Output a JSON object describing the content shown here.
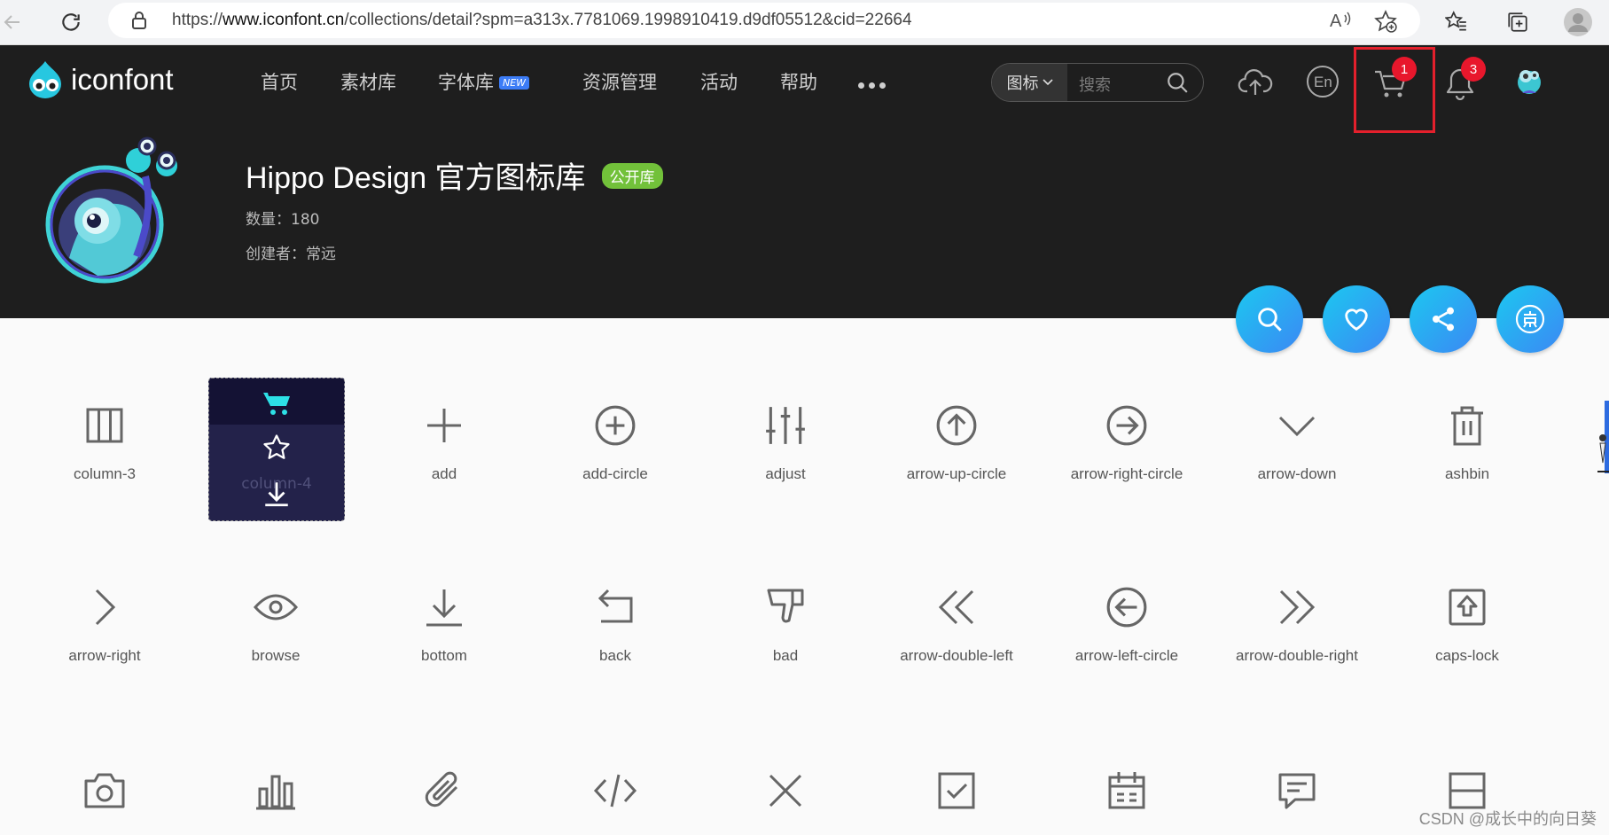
{
  "browser": {
    "url_prefix": "https://",
    "url_host": "www.iconfont.cn",
    "url_path": "/collections/detail?spm=a313x.7781069.1998910419.d9df05512&cid=22664"
  },
  "site": {
    "logo_text": "iconfont",
    "nav": [
      {
        "label": "首页"
      },
      {
        "label": "素材库"
      },
      {
        "label": "字体库",
        "badge": "NEW"
      },
      {
        "label": "资源管理"
      },
      {
        "label": "活动"
      },
      {
        "label": "帮助"
      }
    ],
    "search": {
      "scope": "图标",
      "placeholder": "搜索"
    },
    "cart_count": "1",
    "notification_count": "3"
  },
  "collection": {
    "title": "Hippo Design 官方图标库",
    "visibility_badge": "公开库",
    "count_label": "数量：",
    "count_value": "180",
    "creator_label": "创建者：",
    "creator_value": "常远"
  },
  "hover_card": {
    "label": "column-4"
  },
  "icons": [
    {
      "name": "column-3",
      "icon": "column-3-icon"
    },
    {
      "name": "column-4",
      "icon": "column-4-icon"
    },
    {
      "name": "add",
      "icon": "add-icon"
    },
    {
      "name": "add-circle",
      "icon": "add-circle-icon"
    },
    {
      "name": "adjust",
      "icon": "adjust-icon"
    },
    {
      "name": "arrow-up-circle",
      "icon": "arrow-up-circle-icon"
    },
    {
      "name": "arrow-right-circle",
      "icon": "arrow-right-circle-icon"
    },
    {
      "name": "arrow-down",
      "icon": "arrow-down-icon"
    },
    {
      "name": "ashbin",
      "icon": "ashbin-icon"
    },
    {
      "name": "arrow-right",
      "icon": "arrow-right-icon"
    },
    {
      "name": "browse",
      "icon": "browse-icon"
    },
    {
      "name": "bottom",
      "icon": "bottom-icon"
    },
    {
      "name": "back",
      "icon": "back-icon"
    },
    {
      "name": "bad",
      "icon": "bad-icon"
    },
    {
      "name": "arrow-double-left",
      "icon": "arrow-double-left-icon"
    },
    {
      "name": "arrow-left-circle",
      "icon": "arrow-left-circle-icon"
    },
    {
      "name": "arrow-double-right",
      "icon": "arrow-double-right-icon"
    },
    {
      "name": "caps-lock",
      "icon": "caps-lock-icon"
    }
  ],
  "watermark": "CSDN @成长中的向日葵",
  "colors": {
    "accent": "#3b88f4",
    "badge": "#e8172c",
    "public": "#72c13a",
    "header_bg": "#1e1e1e",
    "highlight": "#e4202c"
  }
}
